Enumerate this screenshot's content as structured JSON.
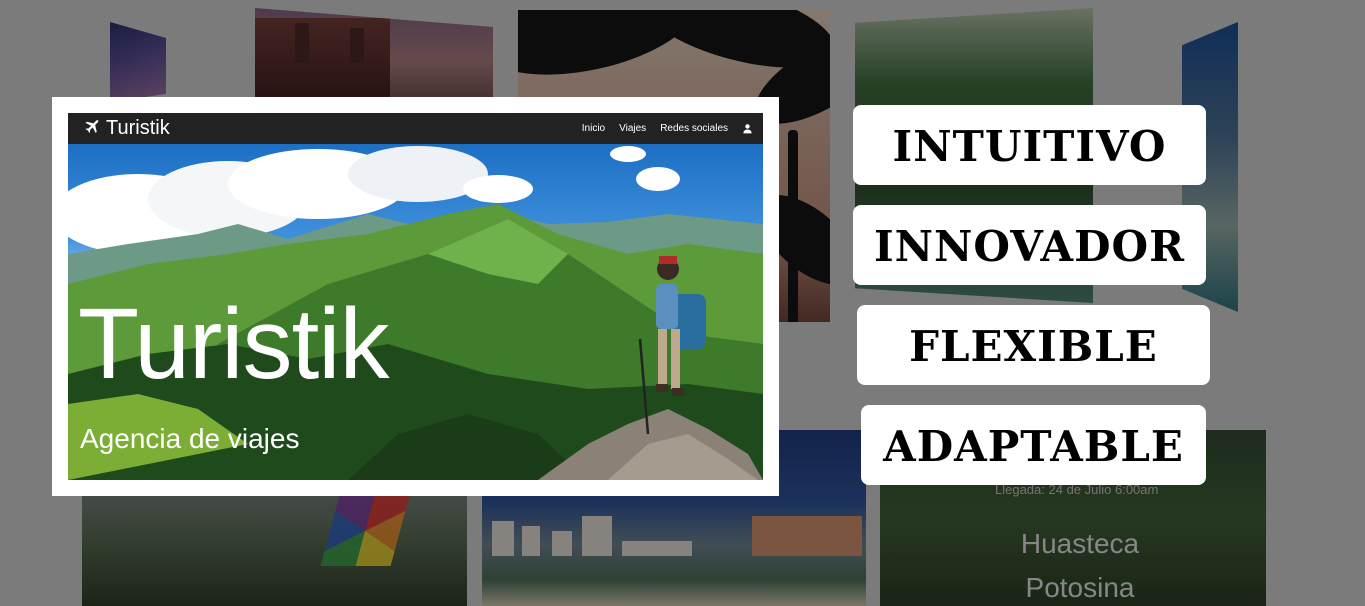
{
  "background_tiles": {
    "city_card": {
      "arrival": "Llegada: 24 de Julio 6:00am",
      "destination": "Huasteca Potosina"
    }
  },
  "preview": {
    "brand": "Turistik",
    "nav": {
      "inicio": "Inicio",
      "viajes": "Viajes",
      "redes": "Redes sociales"
    },
    "hero_title": "Turistik",
    "hero_subtitle": "Agencia de viajes"
  },
  "keywords": {
    "k1": "INTUITIVO",
    "k2": "INNOVADOR",
    "k3": "FLEXIBLE",
    "k4": "ADAPTABLE"
  },
  "colors": {
    "background": "#7b7b7b",
    "navbar": "#222222",
    "badge": "#ffffff"
  },
  "icons": {
    "brand": "airplane-icon",
    "account": "user-icon"
  }
}
